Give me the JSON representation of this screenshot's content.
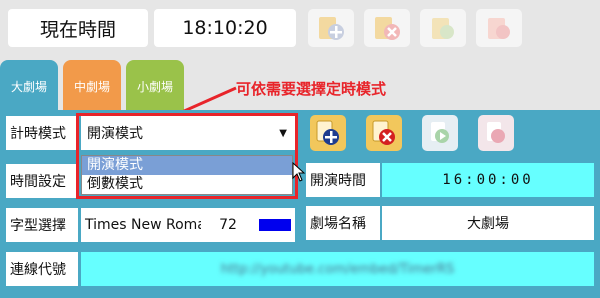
{
  "clock": {
    "label": "現在時間",
    "time": "18:10:20"
  },
  "tabs": [
    {
      "label": "大劇場",
      "color": "#4aa8c4"
    },
    {
      "label": "中劇場",
      "color": "#f29a4a"
    },
    {
      "label": "小劇場",
      "color": "#9ac24a"
    }
  ],
  "annotation": "可依需要選擇定時模式",
  "form": {
    "mode_label": "計時模式",
    "mode_selected": "開演模式",
    "mode_options": [
      "開演模式",
      "倒數模式"
    ],
    "time_setting_label": "時間設定",
    "font_label": "字型選擇",
    "font_value": "Times New Roman",
    "font_size": "72",
    "font_color": "#0000ee",
    "start_time_label": "開演時間",
    "start_time_value": "16:00:00",
    "theater_label": "劇場名稱",
    "theater_value": "大劇場",
    "connection_label": "連線代號",
    "connection_value": "http://youtube.com/embed/TimerRS"
  },
  "colors": {
    "accent": "#e8242a",
    "highlight": "#7a9fd6",
    "cyan": "#66ffff"
  }
}
